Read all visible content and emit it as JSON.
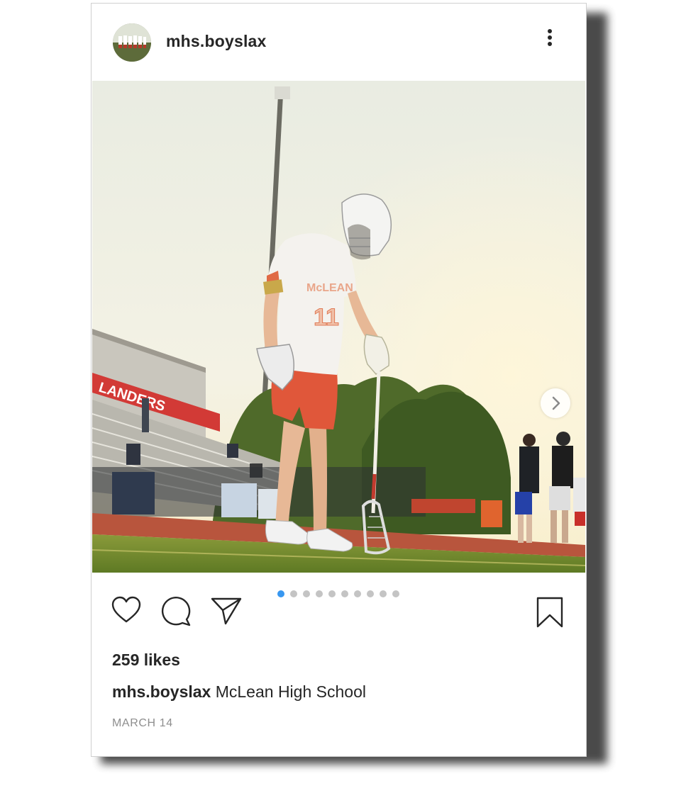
{
  "post": {
    "username": "mhs.boyslax",
    "likes_text": "259 likes",
    "caption_user": "mhs.boyslax",
    "caption_text": "McLean High School",
    "date": "MARCH 14",
    "carousel": {
      "total": 10,
      "active_index": 0
    }
  },
  "photo": {
    "banner_text": "LANDERS",
    "jersey_text": "McLEAN",
    "jersey_number": "11"
  },
  "icons": {
    "more": "more-vertical-icon",
    "like": "heart-icon",
    "comment": "comment-bubble-icon",
    "share": "paper-plane-icon",
    "save": "bookmark-icon",
    "next": "chevron-right-icon"
  },
  "colors": {
    "carousel_active": "#3897f0",
    "carousel_inactive": "#c4c4c4",
    "text": "#262626",
    "muted": "#8e8e8e"
  }
}
